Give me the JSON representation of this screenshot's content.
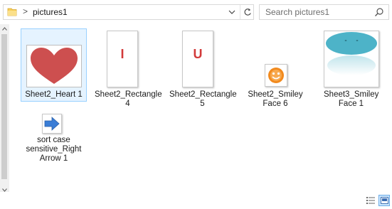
{
  "address_bar": {
    "separator": ">",
    "path": "pictures1"
  },
  "search": {
    "placeholder": "Search pictures1"
  },
  "items": [
    {
      "label": "Sheet2_Heart 1",
      "selected": true
    },
    {
      "label": "Sheet2_Rectangle 4",
      "glyph": "I"
    },
    {
      "label": "Sheet2_Rectangle 5",
      "glyph": "U"
    },
    {
      "label": "Sheet2_Smiley Face 6"
    },
    {
      "label": "Sheet3_Smiley Face 1"
    },
    {
      "label": "sort case sensitive_Right Arrow 1"
    }
  ],
  "colors": {
    "heart": "#cd4f4f",
    "glyph_red": "#d23a3a",
    "smiley_orange": "#f28a1e",
    "teal_ellipse": "#4db3c8",
    "arrow_blue": "#3a7dd6",
    "selection": "#e5f3ff"
  },
  "view_buttons": [
    {
      "icon": "details-view-icon",
      "active": false
    },
    {
      "icon": "large-icons-view-icon",
      "active": true
    }
  ]
}
